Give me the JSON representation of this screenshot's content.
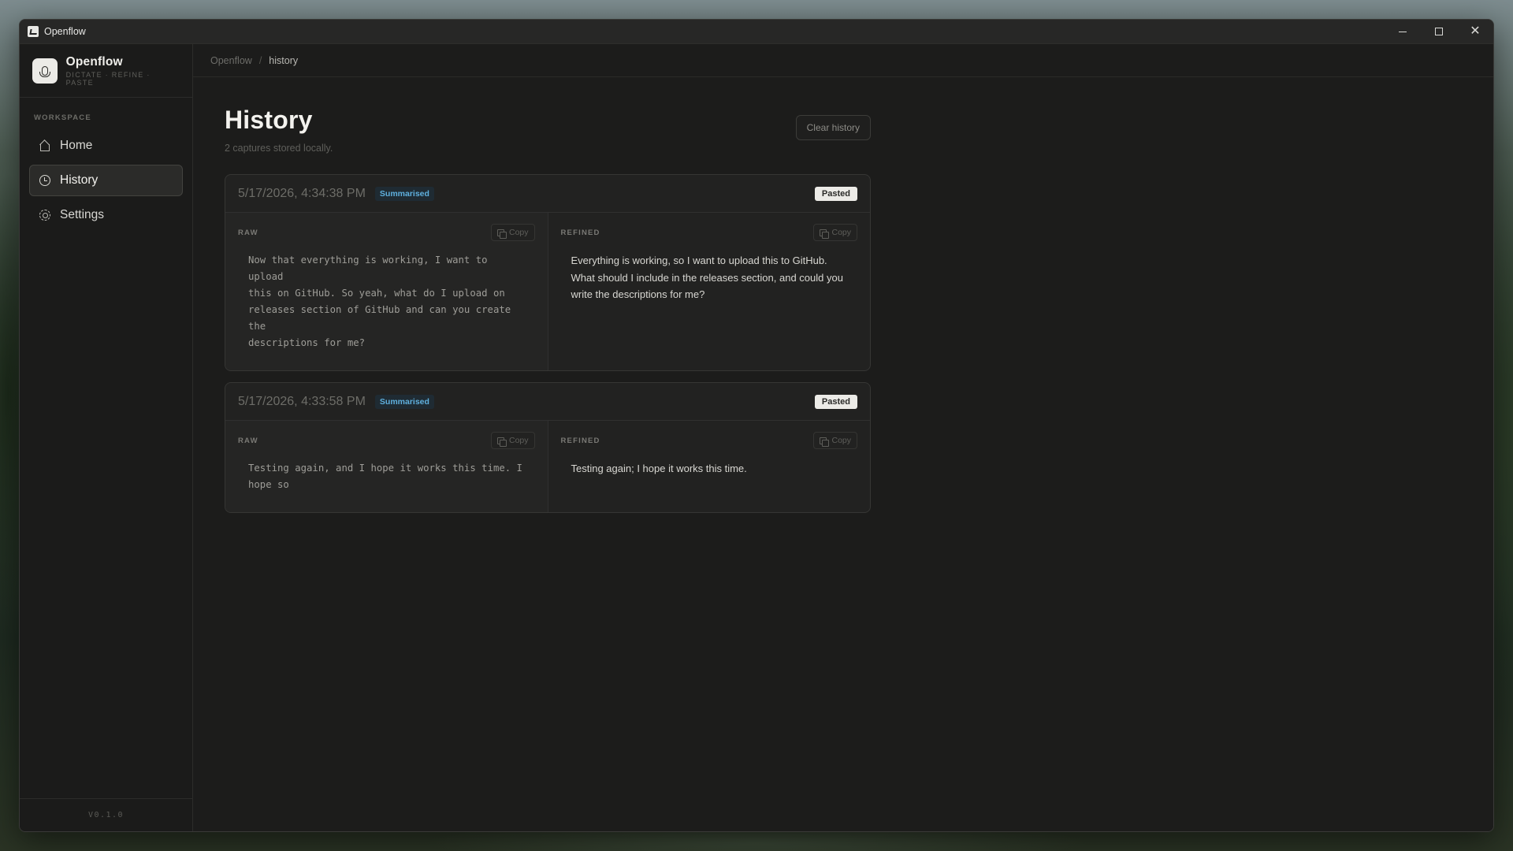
{
  "window": {
    "title": "Openflow"
  },
  "brand": {
    "name": "Openflow",
    "tagline": "DICTATE · REFINE · PASTE"
  },
  "sidebar": {
    "section_heading": "WORKSPACE",
    "items": [
      {
        "label": "Home",
        "icon": "home-icon",
        "active": false
      },
      {
        "label": "History",
        "icon": "clock-icon",
        "active": true
      },
      {
        "label": "Settings",
        "icon": "gear-icon",
        "active": false
      }
    ],
    "version": "V0.1.0"
  },
  "breadcrumb": {
    "root": "Openflow",
    "separator": "/",
    "current": "history"
  },
  "page": {
    "title": "History",
    "subtitle": "2 captures stored locally.",
    "clear_button": "Clear history"
  },
  "captures": [
    {
      "date": "5/17/2026, 4:34:38 PM",
      "mode_badge": "Summarised",
      "status_badge": "Pasted",
      "raw_label": "RAW",
      "refined_label": "REFINED",
      "copy_label": "Copy",
      "raw_text": "Now that everything is working, I want to upload\nthis on GitHub. So yeah, what do I upload on\nreleases section of GitHub and can you create the\ndescriptions for me?",
      "refined_text": "Everything is working, so I want to upload this to GitHub. What should I include in the releases section, and could you write the descriptions for me?"
    },
    {
      "date": "5/17/2026, 4:33:58 PM",
      "mode_badge": "Summarised",
      "status_badge": "Pasted",
      "raw_label": "RAW",
      "refined_label": "REFINED",
      "copy_label": "Copy",
      "raw_text": "Testing again, and I hope it works this time. I\nhope so",
      "refined_text": "Testing again; I hope it works this time."
    }
  ],
  "colors": {
    "accent_badge_text": "#5fb0de",
    "accent_badge_bg": "#1f2b33",
    "window_bg": "#1c1c1b"
  }
}
